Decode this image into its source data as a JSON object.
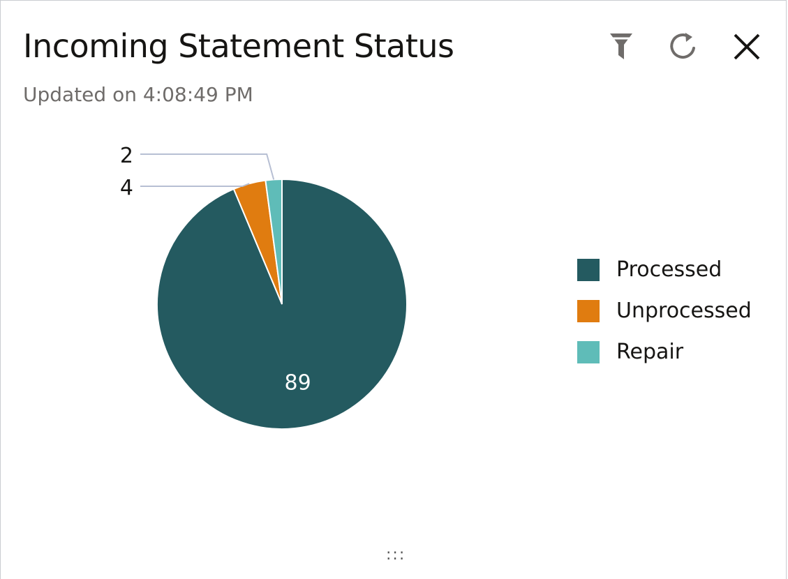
{
  "header": {
    "title": "Incoming Statement Status",
    "subtitle": "Updated on 4:08:49 PM"
  },
  "toolbar": {
    "filter_icon": "filter-icon",
    "refresh_icon": "refresh-icon",
    "close_icon": "close-icon"
  },
  "footer": {
    "resize_handle": ":::"
  },
  "chart_data": {
    "type": "pie",
    "title": "",
    "slices": [
      {
        "label": "Processed",
        "value": 89,
        "color": "#245a60"
      },
      {
        "label": "Unprocessed",
        "value": 4,
        "color": "#e07c10"
      },
      {
        "label": "Repair",
        "value": 2,
        "color": "#5fbcb8"
      }
    ],
    "legend": {
      "position": "right",
      "items": [
        "Processed",
        "Unprocessed",
        "Repair"
      ]
    }
  }
}
